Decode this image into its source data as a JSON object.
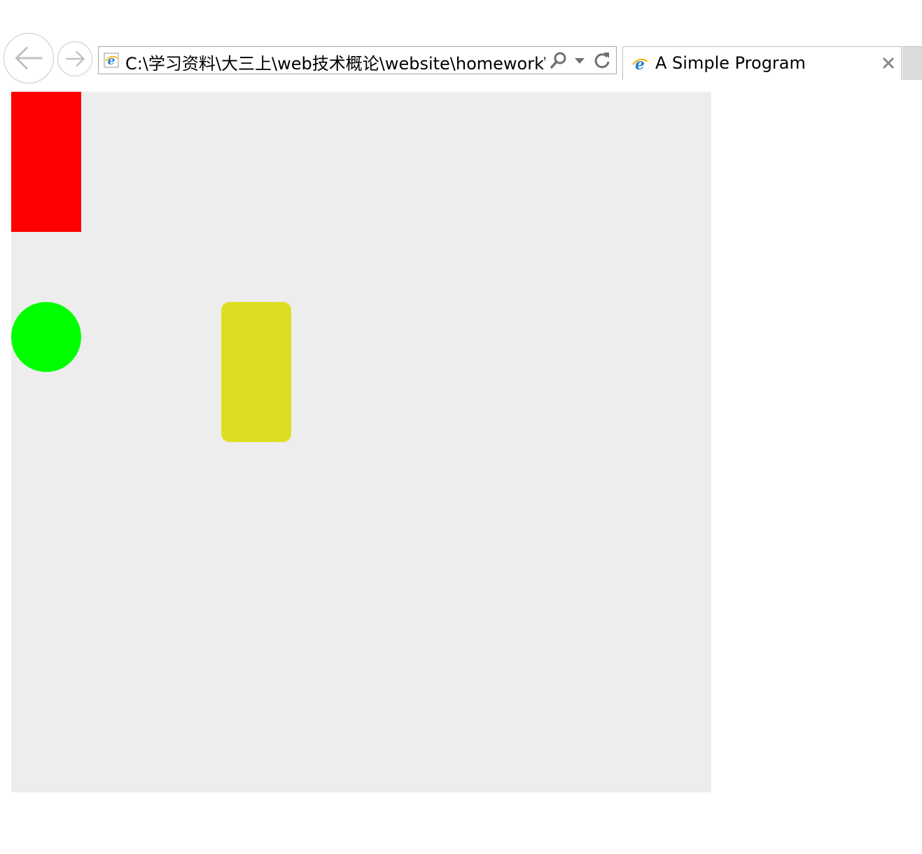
{
  "browser": {
    "address": "C:\\学习资料\\大三上\\web技术概论\\website\\homework\\",
    "tab_title": "A Simple Program",
    "icons": {
      "back": "back-arrow-icon",
      "forward": "forward-arrow-icon",
      "page": "ie-page-icon",
      "search": "search-icon",
      "dropdown": "chevron-down-icon",
      "refresh": "refresh-icon",
      "close": "close-icon"
    }
  },
  "canvas": {
    "background": "#EDEDED",
    "shapes": [
      {
        "name": "red-rectangle",
        "shape": "rectangle",
        "color": "#FF0000"
      },
      {
        "name": "green-circle",
        "shape": "circle",
        "color": "#00FF00"
      },
      {
        "name": "yellow-rounded-rectangle",
        "shape": "rounded-rectangle",
        "color": "#DDDD22"
      }
    ]
  },
  "colors": {
    "chrome_border": "#A8A8A8",
    "new_tab_bg": "#DCDCDC"
  }
}
